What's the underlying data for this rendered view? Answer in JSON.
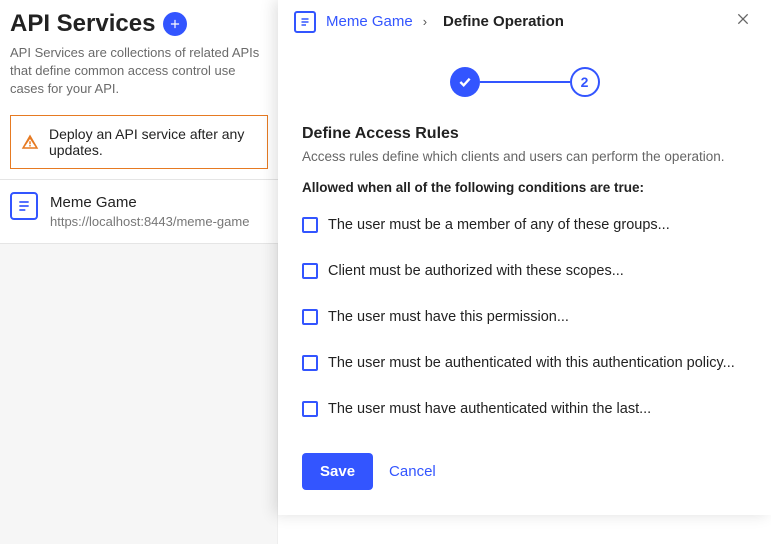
{
  "page": {
    "title": "API Services",
    "description": "API Services are collections of related APIs that define common access control use cases for your API."
  },
  "alert": {
    "text": "Deploy an API service after any updates."
  },
  "services": [
    {
      "name": "Meme Game",
      "url": "https://localhost:8443/meme-game"
    }
  ],
  "panel": {
    "breadcrumb_link": "Meme Game",
    "breadcrumb_current": "Define Operation",
    "step_completed": "1",
    "step_current": "2",
    "section_title": "Define Access Rules",
    "section_desc": "Access rules define which clients and users can perform the operation.",
    "conditions_title": "Allowed when all of the following conditions are true:",
    "rules": [
      "The user must be a member of any of these groups...",
      "Client must be authorized with these scopes...",
      "The user must have this permission...",
      "The user must be authenticated with this authentication policy...",
      "The user must have authenticated within the last..."
    ],
    "save_label": "Save",
    "cancel_label": "Cancel"
  }
}
